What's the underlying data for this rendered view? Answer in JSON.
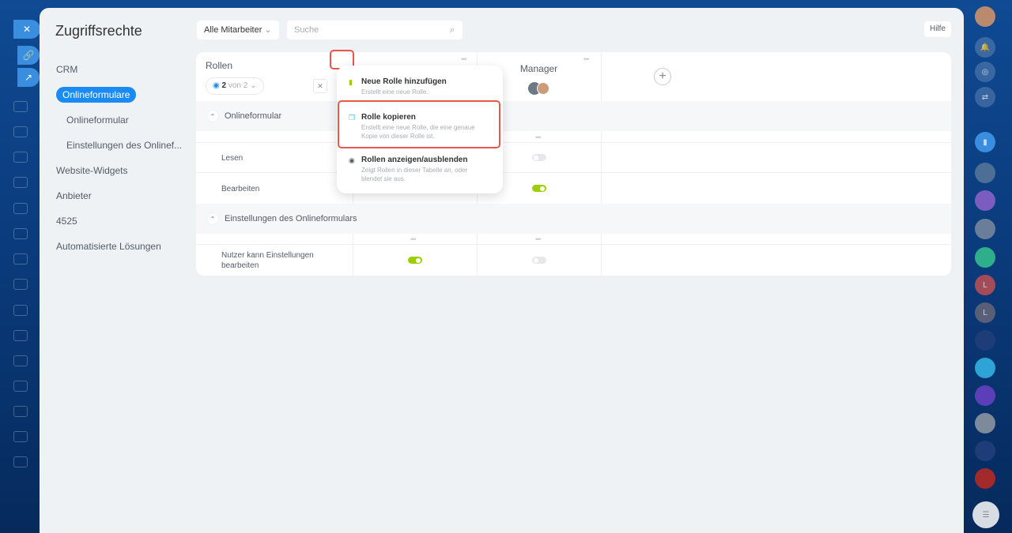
{
  "page": {
    "title": "Zugriffsrechte",
    "help_label": "Hilfe"
  },
  "toolbar": {
    "filter_label": "Alle Mitarbeiter",
    "search_placeholder": "Suche"
  },
  "nav": {
    "items": [
      "CRM",
      "Onlineformulare",
      "Onlineformular",
      "Einstellungen des Onlinef...",
      "Website-Widgets",
      "Anbieter",
      "4525",
      "Automatisierte Lösungen"
    ]
  },
  "table": {
    "roles_header": "Rollen",
    "visible_count": "2",
    "visible_of": "von 2",
    "columns": [
      "",
      "Manager"
    ],
    "sections": [
      {
        "title": "Onlineformular",
        "rows": [
          {
            "label": "Lesen",
            "values": [
              null,
              false
            ]
          },
          {
            "label": "Bearbeiten",
            "values": [
              null,
              true
            ]
          }
        ]
      },
      {
        "title": "Einstellungen des Onlineformulars",
        "rows": [
          {
            "label": "Nutzer kann Einstellungen bearbeiten",
            "values": [
              true,
              false
            ]
          }
        ]
      }
    ]
  },
  "menu": {
    "items": [
      {
        "title": "Neue Rolle hinzufügen",
        "desc": "Erstellt eine neue Rolle."
      },
      {
        "title": "Rolle kopieren",
        "desc": "Erstellt eine neue Rolle, die eine genaue Kopie von dieser Rolle ist."
      },
      {
        "title": "Rollen anzeigen/ausblenden",
        "desc": "Zeigt Rollen in dieser Tabelle an, oder blendet sie aus."
      }
    ]
  },
  "rightbar": {
    "letters": [
      "L",
      "L"
    ]
  },
  "colors": {
    "accent": "#1a8bf5",
    "toggle_on": "#9dcf00",
    "highlight": "#e8584a"
  }
}
